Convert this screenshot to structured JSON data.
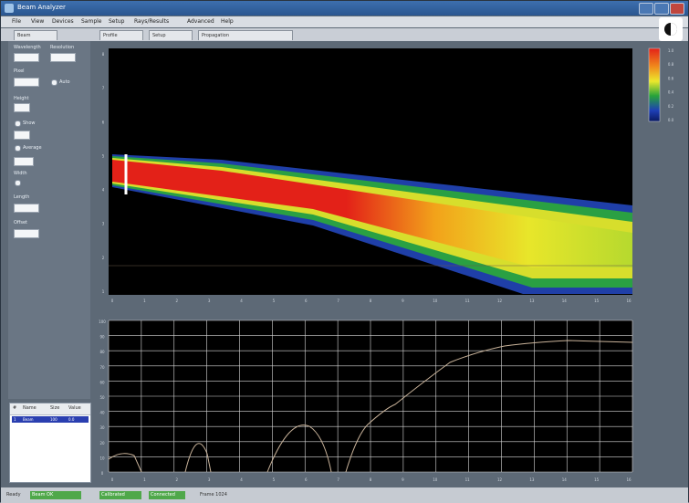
{
  "window": {
    "title": "Beam Analyzer"
  },
  "menu": [
    "File",
    "View",
    "Devices",
    "Sample",
    "Setup",
    "Rays/Results",
    "Advanced",
    "Help"
  ],
  "tabs": [
    "Beam",
    "Profile",
    "Setup",
    "Propagation"
  ],
  "left_panel": {
    "fields": [
      {
        "label": "Wavelength",
        "value": ""
      },
      {
        "label": "Resolution",
        "value": ""
      },
      {
        "label": "Pixel",
        "value": ""
      },
      {
        "label": "Height",
        "value": ""
      },
      {
        "label": "Offset",
        "value": ""
      },
      {
        "label": "Width",
        "value": ""
      },
      {
        "label": "Length",
        "value": ""
      }
    ],
    "checkboxes": [
      "Auto",
      "Show",
      "Average"
    ]
  },
  "table": {
    "headers": [
      "#",
      "Name",
      "Size",
      "Value"
    ],
    "selected_row": [
      "1",
      "Beam",
      "100",
      "0.0"
    ]
  },
  "plot_top": {
    "x_ticks": [
      "0",
      "1",
      "2",
      "3",
      "4",
      "5",
      "6",
      "7",
      "8",
      "9",
      "10",
      "11",
      "12",
      "13",
      "14",
      "15",
      "16"
    ],
    "y_ticks": [
      "8",
      "7",
      "6",
      "5",
      "4",
      "3",
      "2",
      "1"
    ],
    "colorbar_ticks": [
      "1.0",
      "0.8",
      "0.6",
      "0.4",
      "0.2",
      "0.0"
    ]
  },
  "plot_bottom": {
    "x_ticks": [
      "0",
      "1",
      "2",
      "3",
      "4",
      "5",
      "6",
      "7",
      "8",
      "9",
      "10",
      "11",
      "12",
      "13",
      "14",
      "15",
      "16"
    ],
    "y_ticks": [
      "100",
      "90",
      "80",
      "70",
      "60",
      "50",
      "40",
      "30",
      "20",
      "10",
      "0"
    ]
  },
  "status": {
    "label": "Ready",
    "segments": [
      "Beam OK",
      "Calibrated",
      "Connected",
      "Frame 1024"
    ]
  },
  "colors": {
    "beam_red": "#e32118",
    "plot_bg": "#000000",
    "grid": "#d8d8d8",
    "status_green": "#4fa84a"
  }
}
